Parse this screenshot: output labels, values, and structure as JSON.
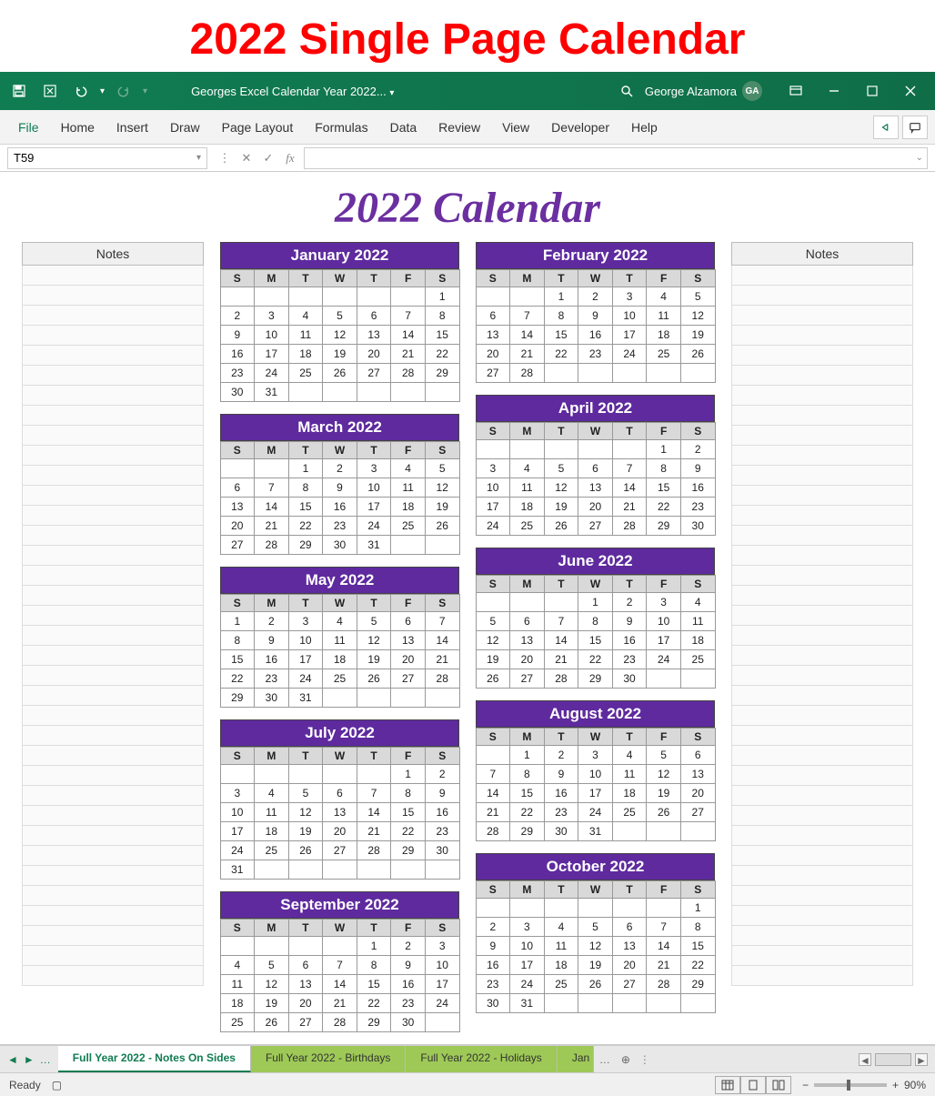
{
  "banner": "2022 Single Page Calendar",
  "titlebar": {
    "doc_title": "Georges Excel Calendar Year 2022...",
    "user_name": "George Alzamora",
    "user_initials": "GA"
  },
  "ribbon": {
    "tabs": [
      "File",
      "Home",
      "Insert",
      "Draw",
      "Page Layout",
      "Formulas",
      "Data",
      "Review",
      "View",
      "Developer",
      "Help"
    ]
  },
  "formulabar": {
    "namebox": "T59",
    "fx_label": "fx",
    "value": ""
  },
  "sheet": {
    "title": "2022 Calendar",
    "notes_label": "Notes",
    "dow": [
      "S",
      "M",
      "T",
      "W",
      "T",
      "F",
      "S"
    ],
    "months": [
      {
        "name": "January 2022",
        "start": 6,
        "days": 31
      },
      {
        "name": "February 2022",
        "start": 2,
        "days": 28
      },
      {
        "name": "March 2022",
        "start": 2,
        "days": 31
      },
      {
        "name": "April 2022",
        "start": 5,
        "days": 30
      },
      {
        "name": "May 2022",
        "start": 0,
        "days": 31
      },
      {
        "name": "June 2022",
        "start": 3,
        "days": 30
      },
      {
        "name": "July 2022",
        "start": 5,
        "days": 31
      },
      {
        "name": "August 2022",
        "start": 1,
        "days": 31
      },
      {
        "name": "September 2022",
        "start": 4,
        "days": 30
      },
      {
        "name": "October 2022",
        "start": 6,
        "days": 31
      }
    ]
  },
  "tabs": {
    "items": [
      "Full Year 2022 - Notes On Sides",
      "Full Year 2022 - Birthdays",
      "Full Year 2022 - Holidays",
      "Jan"
    ],
    "active": 0
  },
  "status": {
    "ready": "Ready",
    "zoom": "90%"
  }
}
